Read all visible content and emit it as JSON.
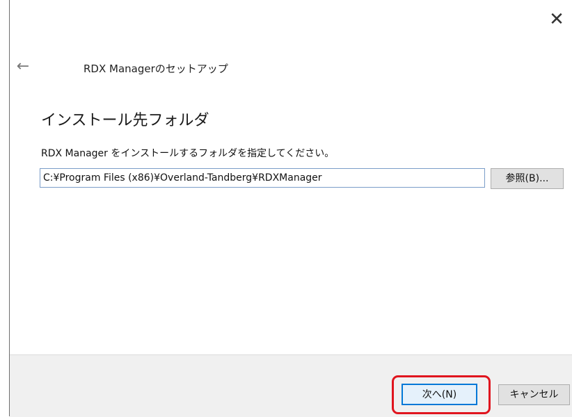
{
  "window": {
    "close_glyph": "✕",
    "back_glyph": "←",
    "title": "RDX Managerのセットアップ"
  },
  "page": {
    "heading": "インストール先フォルダ",
    "instruction": "RDX Manager をインストールするフォルダを指定してください。",
    "install_path": "C:¥Program Files (x86)¥Overland-Tandberg¥RDXManager",
    "browse_label": "参照(B)..."
  },
  "footer": {
    "next_label": "次へ(N)",
    "cancel_label": "キャンセル"
  },
  "annotation": {
    "highlight_color": "#e0141e"
  }
}
